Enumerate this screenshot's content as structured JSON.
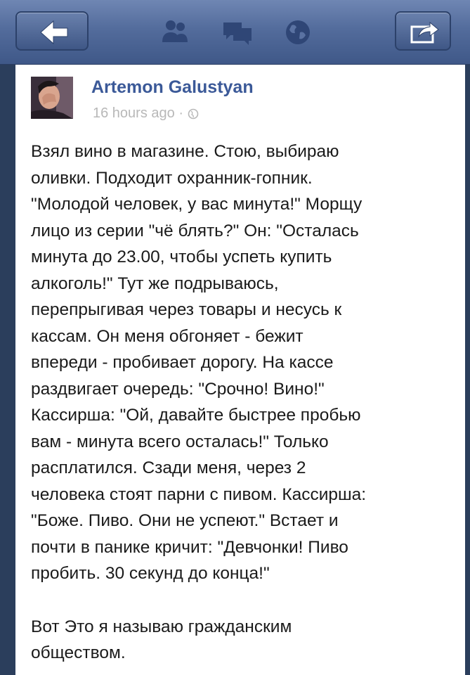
{
  "post": {
    "author": "Artemon Galustyan",
    "time": "16 hours ago ·",
    "lines": [
      "Взял вино в магазине. Стою, выбираю",
      "оливки. Подходит охранник-гопник.",
      "\"Молодой человек, у вас минута!\" Морщу",
      "лицо из серии \"чё блять?\" Он: \"Осталась",
      "минута до 23.00, чтобы успеть купить",
      "алкоголь!\" Тут же подрываюсь,",
      "перепрыгивая через товары и несусь к",
      "кассам. Он меня обгоняет - бежит",
      "впереди - пробивает дорогу. На кассе",
      "раздвигает очередь: \"Срочно! Вино!\"",
      "Кассирша: \"Ой, давайте быстрее пробью",
      "вам - минута всего осталась!\" Только",
      "расплатился. Сзади меня, через 2",
      "человека стоят парни с пивом. Кассирша:",
      "\"Боже. Пиво. Они не успеют.\" Встает и",
      "почти в панике кричит: \"Девчонки! Пиво",
      "пробить. 30 секунд до конца!\""
    ],
    "closing_lines": [
      "Вот Это я называю гражданским",
      "обществом."
    ]
  },
  "icons": {
    "back": "back-arrow-icon",
    "friends": "friend-requests-icon",
    "messages": "messages-icon",
    "notifications": "notifications-globe-icon",
    "share": "share-icon",
    "privacy": "public-globe-icon"
  },
  "colors": {
    "bar": "#536c9c",
    "author": "#3b5998",
    "meta": "#b8b8b8",
    "text": "#1a1a1a"
  }
}
